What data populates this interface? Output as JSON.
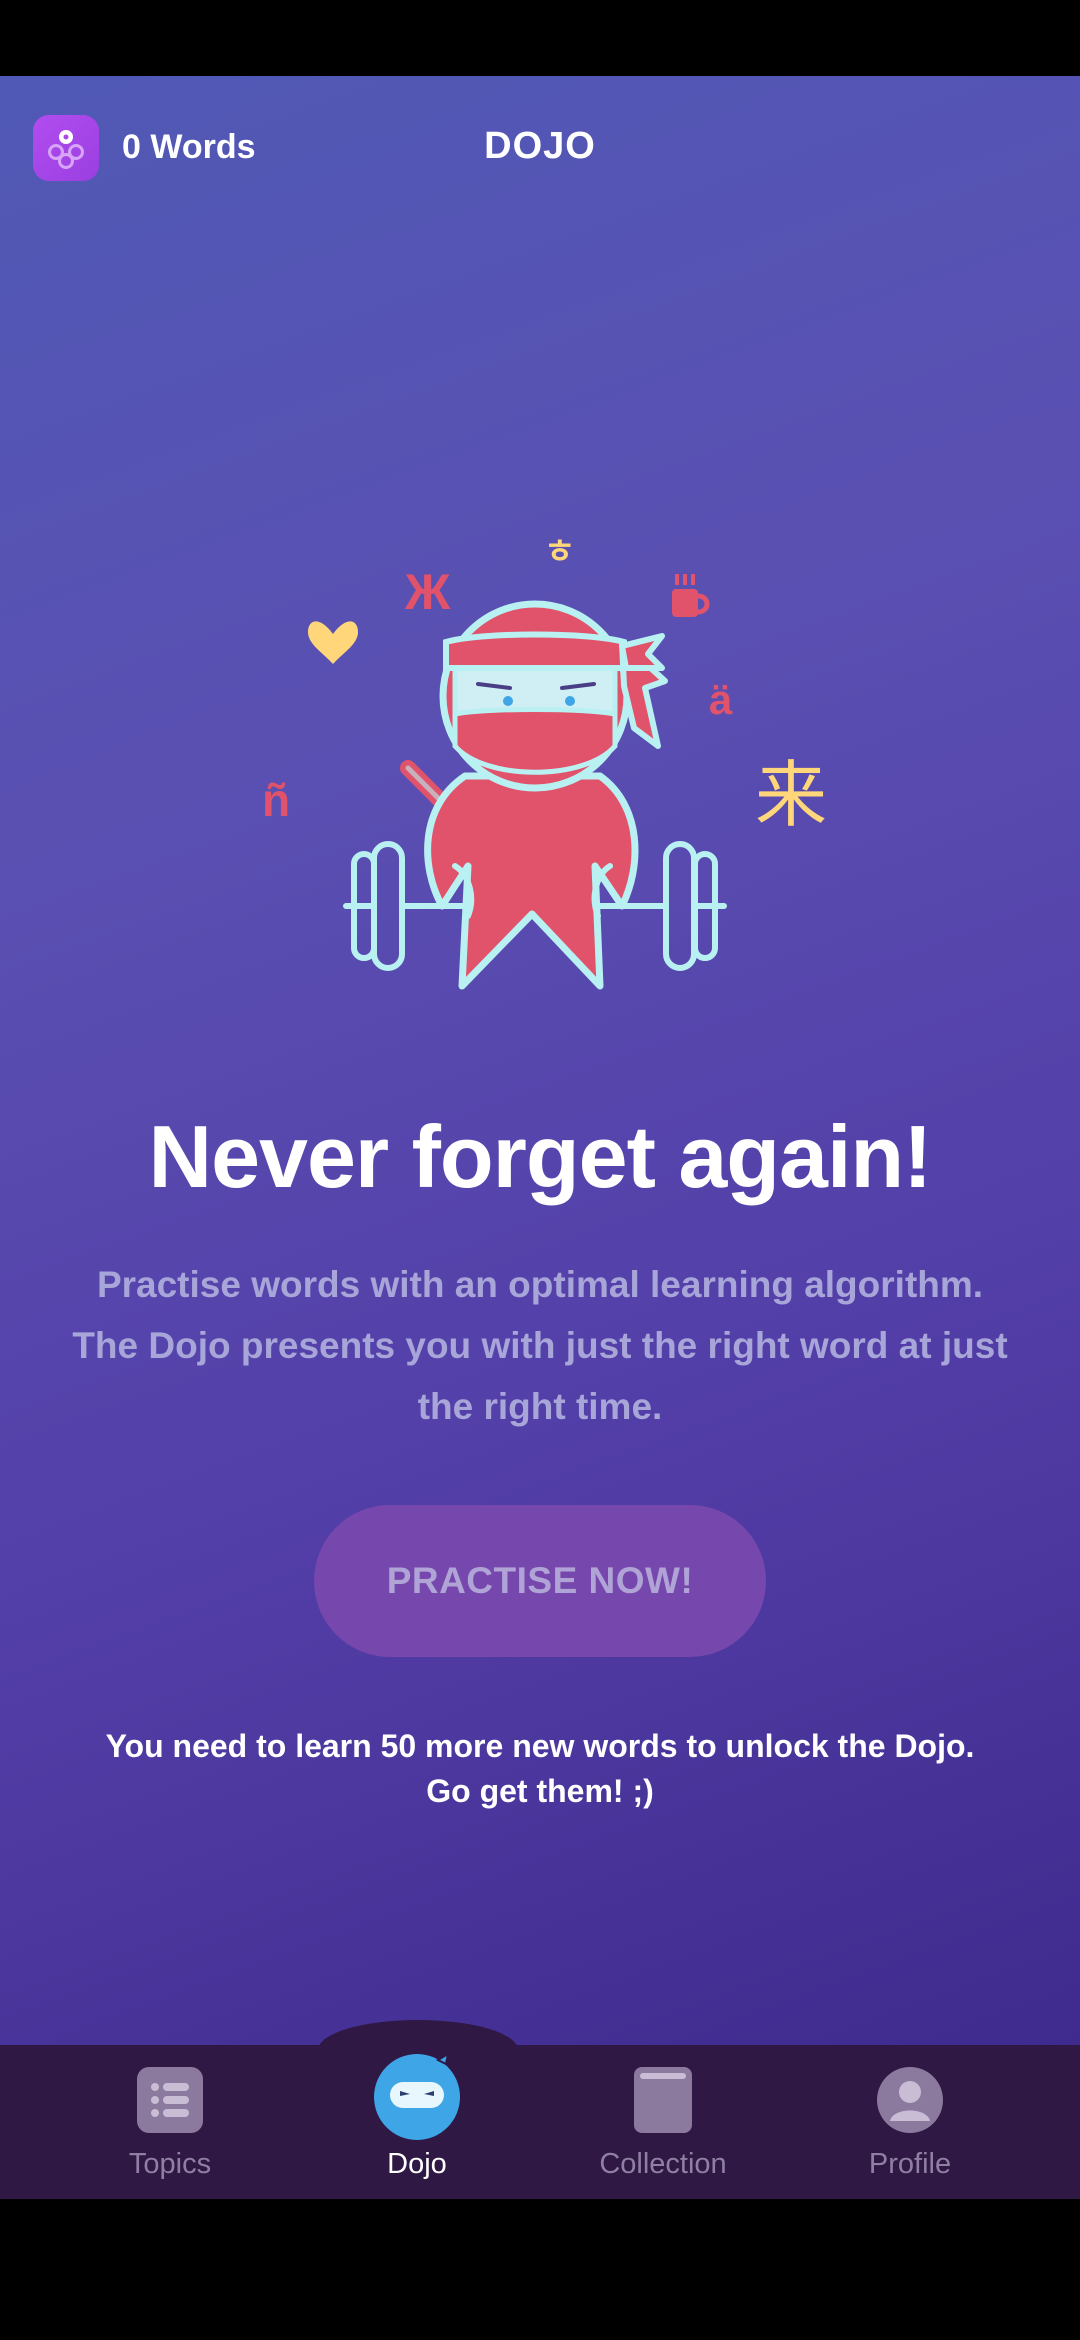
{
  "header": {
    "word_count": "0 Words",
    "title": "DOJO",
    "logo_icon": "app-logo-icon"
  },
  "hero": {
    "glyphs": {
      "zhe": "Ж",
      "hieut": "ㅎ",
      "a_umlaut": "ä",
      "n_tilde": "ñ",
      "lai": "来"
    },
    "icons": [
      "heart-icon",
      "mug-icon",
      "ninja-weightlifter-illustration"
    ]
  },
  "main": {
    "headline": "Never forget again!",
    "description": "Practise words with an optimal learning algorithm. The Dojo presents you with just the right word at just the right time.",
    "cta_label": "PRACTISE NOW!",
    "unlock_note": "You need to learn 50 more new words to unlock the Dojo. Go get them! ;)"
  },
  "nav": {
    "items": [
      {
        "label": "Topics",
        "icon": "list-icon"
      },
      {
        "label": "Dojo",
        "icon": "ninja-face-icon"
      },
      {
        "label": "Collection",
        "icon": "book-icon"
      },
      {
        "label": "Profile",
        "icon": "person-icon"
      }
    ],
    "active": "Dojo"
  },
  "colors": {
    "accent_red": "#e0536b",
    "outline_cyan": "#b9f0f2",
    "yellow": "#ffd67a",
    "nav_background": "#2f1844",
    "dojo_blue": "#3ea6e6"
  }
}
